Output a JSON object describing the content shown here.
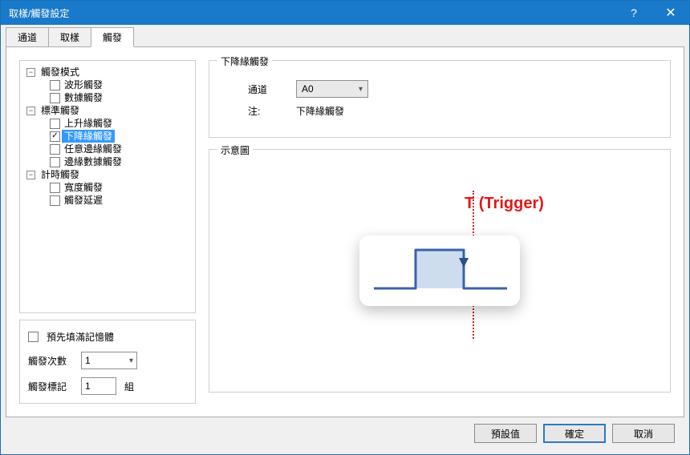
{
  "window": {
    "title": "取樣/觸發設定",
    "help": "?",
    "close": "✕"
  },
  "tabs": {
    "items": [
      "通道",
      "取樣",
      "觸發"
    ],
    "active": 2
  },
  "tree": {
    "nodes": [
      {
        "label": "觸發模式",
        "expand": "−",
        "children": [
          {
            "label": "波形觸發",
            "checked": false
          },
          {
            "label": "數據觸發",
            "checked": false
          }
        ]
      },
      {
        "label": "標準觸發",
        "expand": "−",
        "children": [
          {
            "label": "上升緣觸發",
            "checked": false
          },
          {
            "label": "下降緣觸發",
            "checked": true,
            "selected": true
          },
          {
            "label": "任意邊緣觸發",
            "checked": false
          },
          {
            "label": "邊緣數據觸發",
            "checked": false
          }
        ]
      },
      {
        "label": "計時觸發",
        "expand": "−",
        "children": [
          {
            "label": "寬度觸發",
            "checked": false
          },
          {
            "label": "觸發延遲",
            "checked": false
          }
        ]
      }
    ]
  },
  "bottom": {
    "prefill": {
      "label": "預先填滿記憶體",
      "checked": false
    },
    "count": {
      "label": "觸發次數",
      "value": "1"
    },
    "mark": {
      "label": "觸發標記",
      "value": "1",
      "unit": "組"
    }
  },
  "right": {
    "group1_legend": "下降緣觸發",
    "channel_label": "通道",
    "channel_value": "A0",
    "note_label": "注:",
    "note_value": "下降緣觸發",
    "group2_legend": "示意圖",
    "trigger_text": "T (Trigger)"
  },
  "footer": {
    "defaults": "預設值",
    "ok": "確定",
    "cancel": "取消"
  }
}
